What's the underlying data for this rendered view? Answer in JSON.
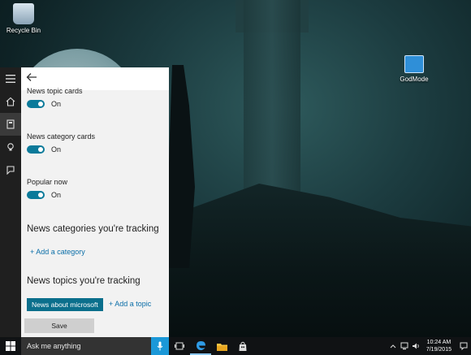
{
  "desktop": {
    "icons": [
      {
        "label": "Recycle Bin",
        "icon": "recycle-bin-icon"
      },
      {
        "label": "GodMode",
        "icon": "godmode-folder-icon"
      }
    ]
  },
  "rail": {
    "items": [
      {
        "icon": "hamburger-menu-icon"
      },
      {
        "icon": "home-icon"
      },
      {
        "icon": "notebook-icon",
        "active": true
      },
      {
        "icon": "lightbulb-icon"
      },
      {
        "icon": "feedback-icon"
      }
    ]
  },
  "panel": {
    "back_icon": "back-arrow-icon",
    "settings": [
      {
        "label": "News topic cards",
        "state": "On"
      },
      {
        "label": "News category cards",
        "state": "On"
      },
      {
        "label": "Popular now",
        "state": "On"
      }
    ],
    "categories_title": "News categories you're tracking",
    "add_category": "+ Add a category",
    "topics_title": "News topics you're tracking",
    "topic_chip": "News about microsoft",
    "add_topic": "+ Add a topic",
    "save_label": "Save"
  },
  "taskbar": {
    "search_placeholder": "Ask me anything",
    "icons": [
      "windows-start-icon",
      "microphone-icon",
      "task-view-icon",
      "edge-icon",
      "file-explorer-icon",
      "store-icon"
    ],
    "time": "10:24 AM",
    "date": "7/19/2015"
  },
  "colors": {
    "accent": "#0b7a9a",
    "chip": "#0b6f8c",
    "link": "#0b6ea8",
    "mic": "#1b98d8"
  }
}
